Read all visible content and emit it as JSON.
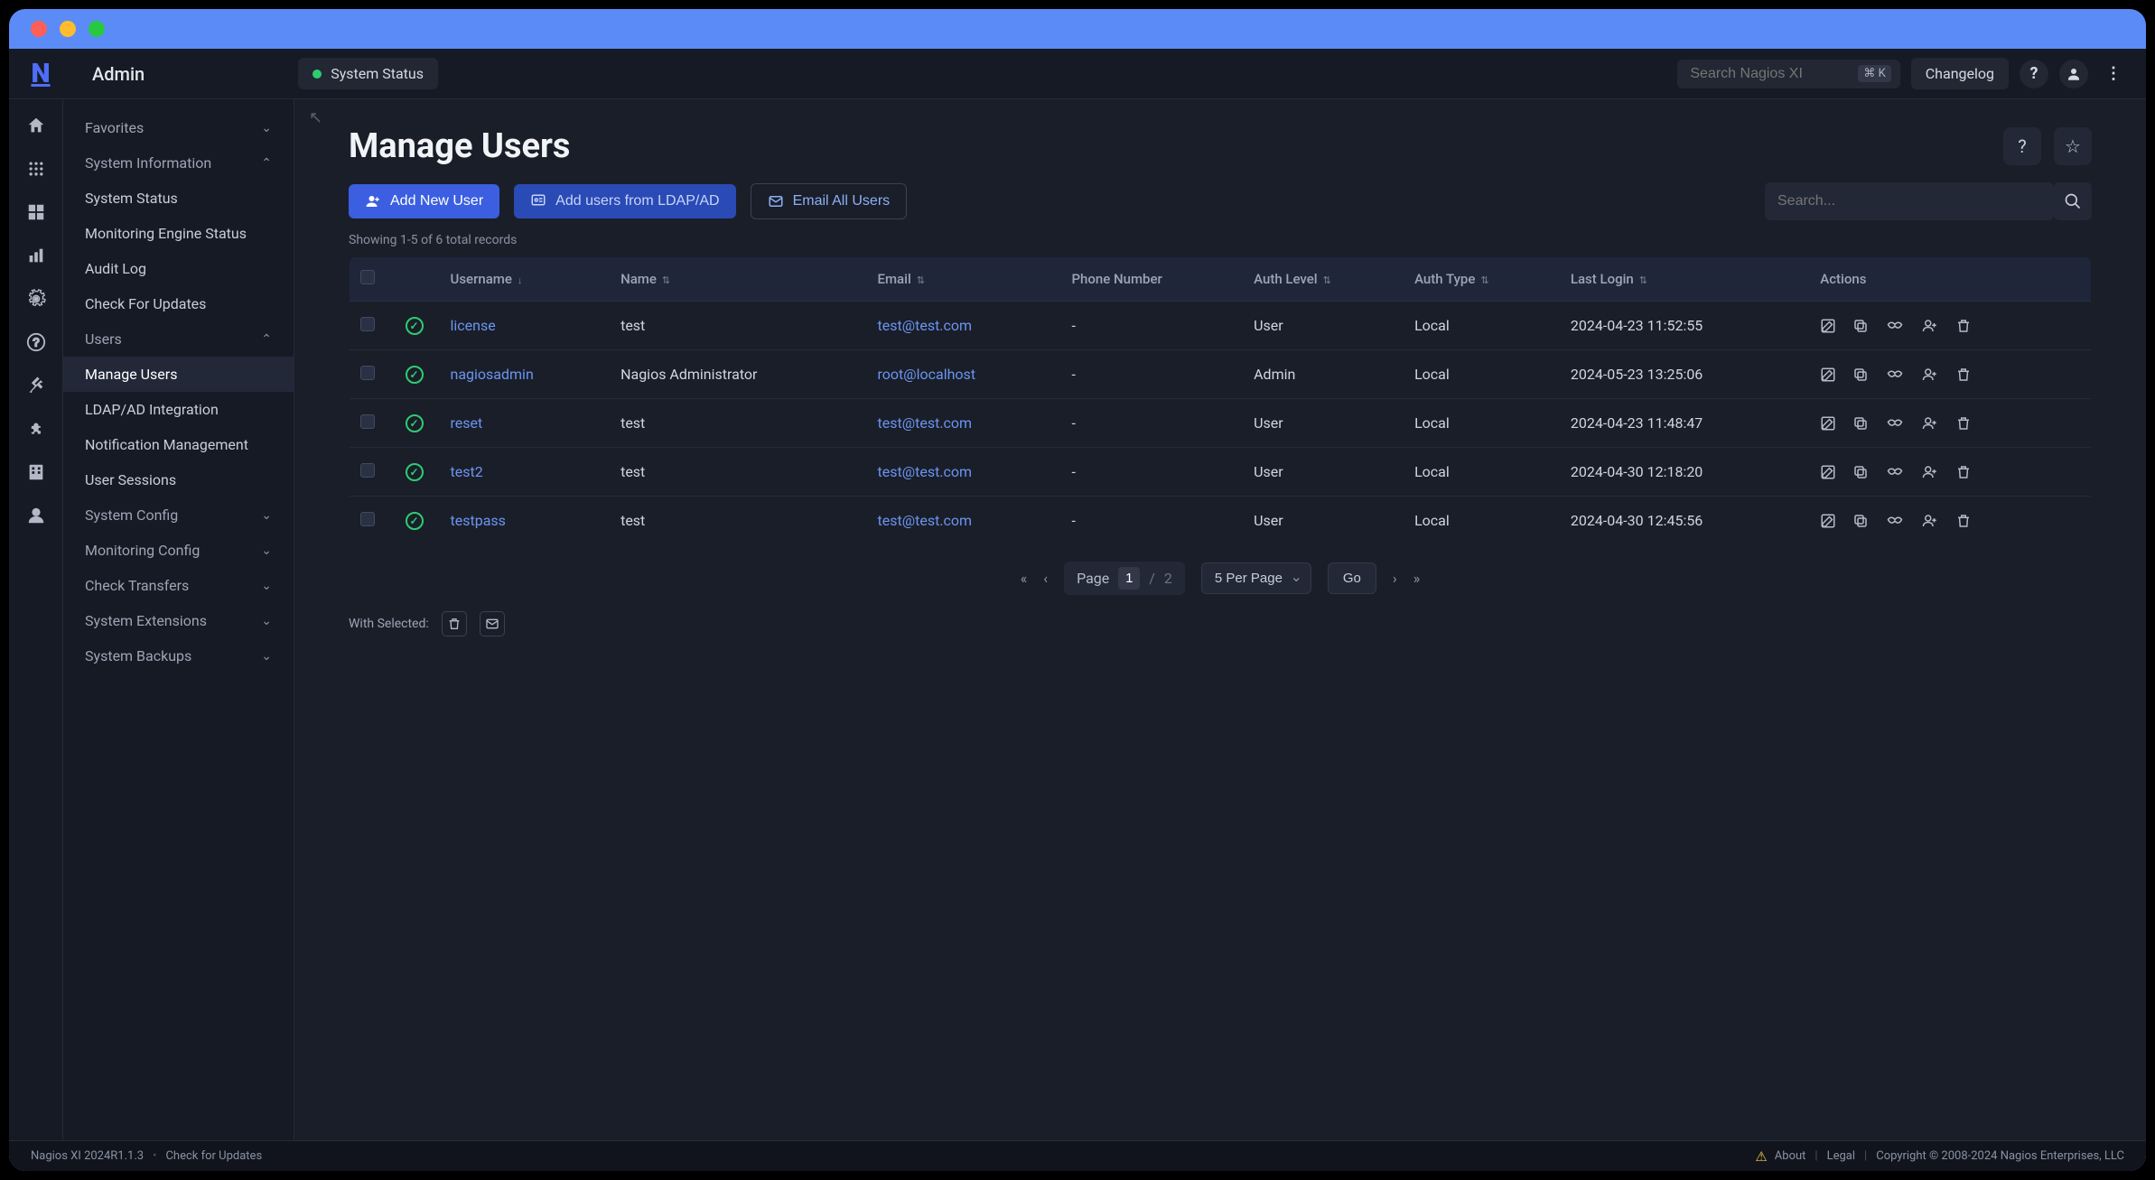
{
  "topbar": {
    "section": "Admin",
    "status_label": "System Status",
    "search_placeholder": "Search Nagios XI",
    "shortcut": "⌘ K",
    "changelog": "Changelog"
  },
  "sidebar": {
    "favorites": "Favorites",
    "sys_info": "System Information",
    "sys_info_items": [
      "System Status",
      "Monitoring Engine Status",
      "Audit Log",
      "Check For Updates"
    ],
    "users": "Users",
    "users_items": [
      "Manage Users",
      "LDAP/AD Integration",
      "Notification Management",
      "User Sessions"
    ],
    "sys_config": "System Config",
    "mon_config": "Monitoring Config",
    "check_transfers": "Check Transfers",
    "sys_ext": "System Extensions",
    "sys_backups": "System Backups"
  },
  "page": {
    "title": "Manage Users",
    "add_new": "Add New User",
    "add_ldap": "Add users from LDAP/AD",
    "email_all": "Email All Users",
    "search_placeholder": "Search...",
    "count": "Showing 1-5 of 6 total records",
    "with_selected": "With Selected:"
  },
  "columns": [
    "",
    "",
    "Username",
    "Name",
    "Email",
    "Phone Number",
    "Auth Level",
    "Auth Type",
    "Last Login",
    "Actions"
  ],
  "rows": [
    {
      "username": "license",
      "name": "test",
      "email": "test@test.com",
      "phone": "-",
      "level": "User",
      "type": "Local",
      "last": "2024-04-23 11:52:55"
    },
    {
      "username": "nagiosadmin",
      "name": "Nagios Administrator",
      "email": "root@localhost",
      "phone": "-",
      "level": "Admin",
      "type": "Local",
      "last": "2024-05-23 13:25:06"
    },
    {
      "username": "reset",
      "name": "test",
      "email": "test@test.com",
      "phone": "-",
      "level": "User",
      "type": "Local",
      "last": "2024-04-23 11:48:47"
    },
    {
      "username": "test2",
      "name": "test",
      "email": "test@test.com",
      "phone": "-",
      "level": "User",
      "type": "Local",
      "last": "2024-04-30 12:18:20"
    },
    {
      "username": "testpass",
      "name": "test",
      "email": "test@test.com",
      "phone": "-",
      "level": "User",
      "type": "Local",
      "last": "2024-04-30 12:45:56"
    }
  ],
  "pager": {
    "page_label": "Page",
    "current": "1",
    "total": "2",
    "sep": "/",
    "per_page": "5 Per Page",
    "go": "Go"
  },
  "footer": {
    "version": "Nagios XI 2024R1.1.3",
    "check_updates": "Check for Updates",
    "about": "About",
    "legal": "Legal",
    "copyright": "Copyright © 2008-2024 Nagios Enterprises, LLC"
  }
}
